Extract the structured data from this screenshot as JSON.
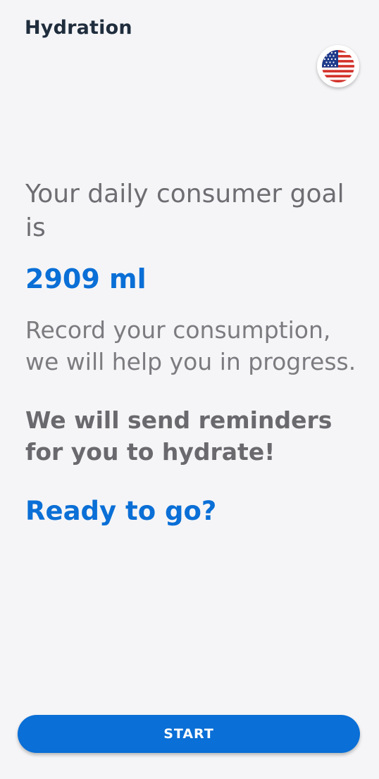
{
  "header": {
    "title": "Hydration",
    "language_icon": "us-flag-icon"
  },
  "main": {
    "goal_text": "Your daily consumer goal is",
    "goal_value": "2909 ml",
    "record_text": "Record your consumption, we will help you in progress.",
    "reminder_text": "We will send reminders for you to hydrate!",
    "ready_text": "Ready to go?"
  },
  "footer": {
    "start_label": "START"
  },
  "colors": {
    "accent": "#0a6fd6",
    "background": "#f5f5f7",
    "title": "#1f2d3d",
    "body_text": "#6d6d72"
  }
}
